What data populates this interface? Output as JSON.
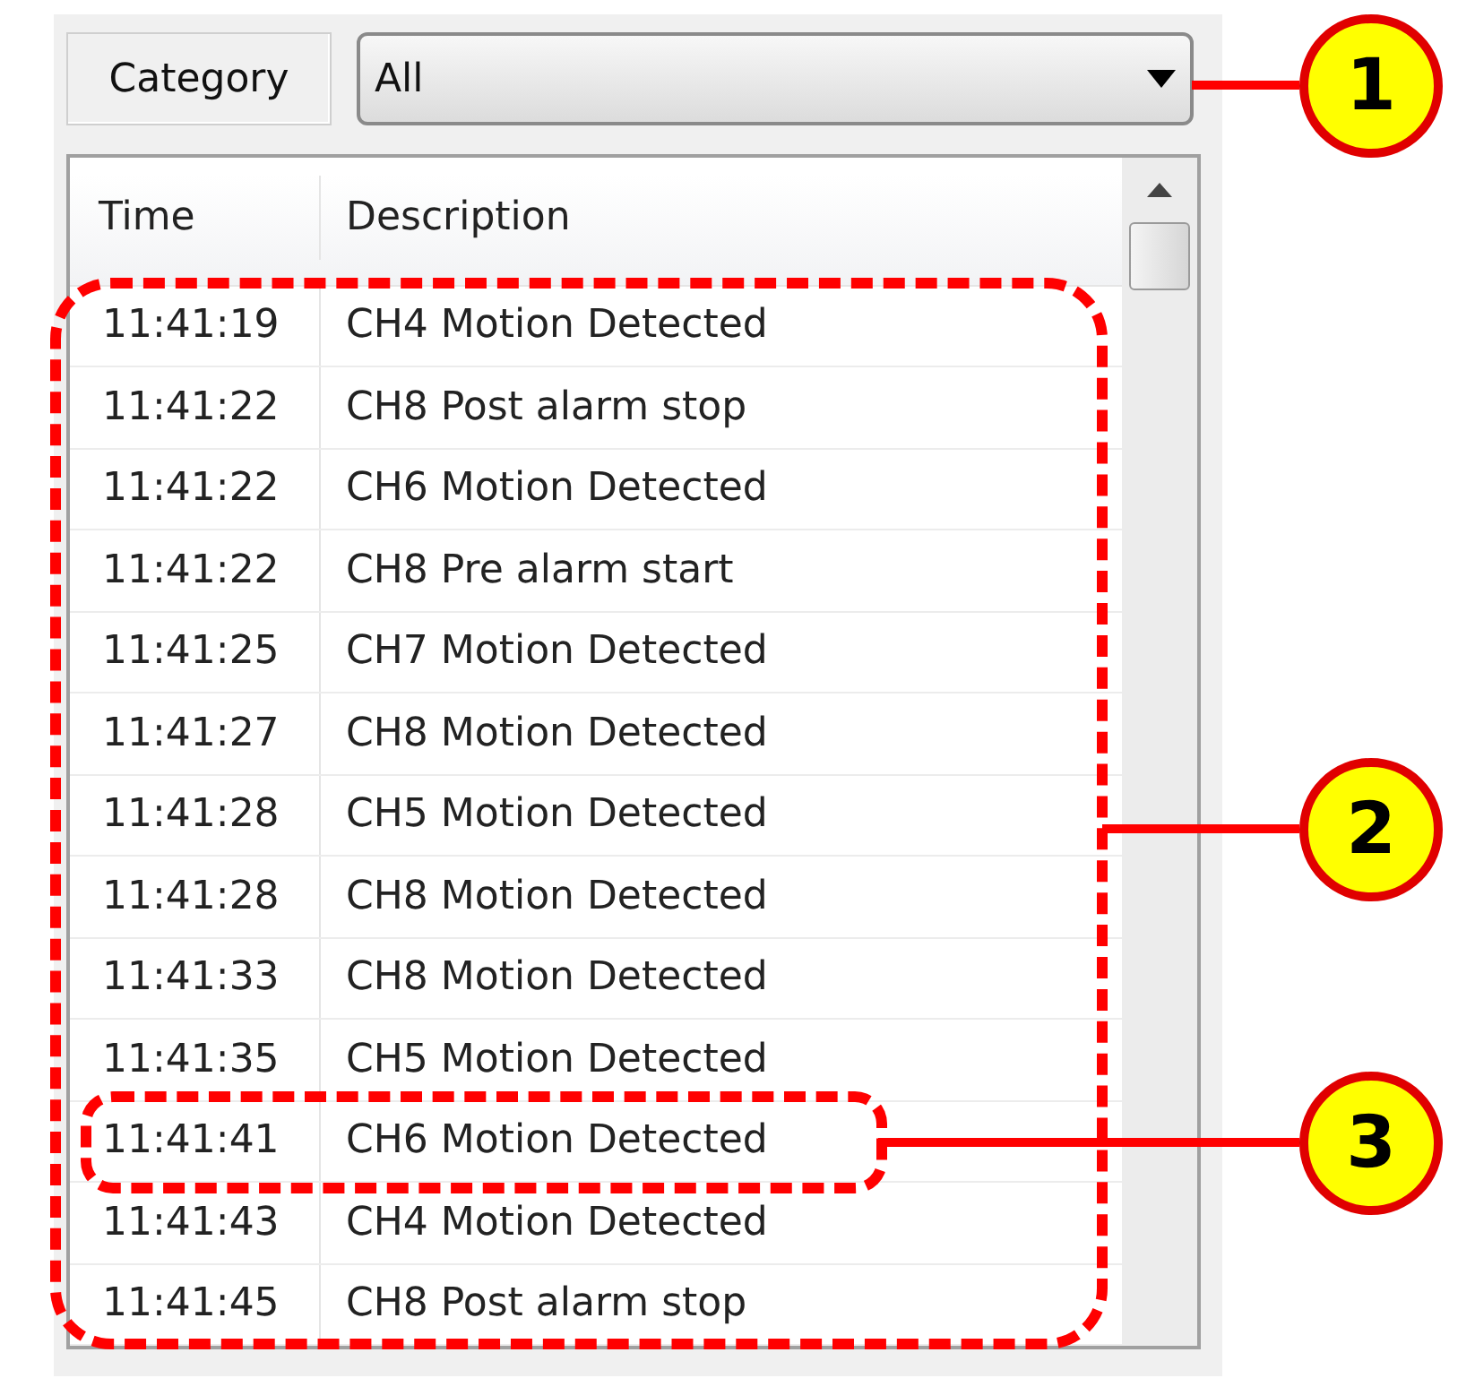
{
  "filter": {
    "label": "Category",
    "value": "All"
  },
  "table": {
    "columns": [
      "Time",
      "Description"
    ],
    "rows": [
      {
        "time": "11:41:19",
        "description": "CH4 Motion Detected"
      },
      {
        "time": "11:41:22",
        "description": "CH8 Post alarm stop"
      },
      {
        "time": "11:41:22",
        "description": "CH6 Motion Detected"
      },
      {
        "time": "11:41:22",
        "description": "CH8 Pre alarm start"
      },
      {
        "time": "11:41:25",
        "description": "CH7 Motion Detected"
      },
      {
        "time": "11:41:27",
        "description": "CH8 Motion Detected"
      },
      {
        "time": "11:41:28",
        "description": "CH5 Motion Detected"
      },
      {
        "time": "11:41:28",
        "description": "CH8 Motion Detected"
      },
      {
        "time": "11:41:33",
        "description": "CH8 Motion Detected"
      },
      {
        "time": "11:41:35",
        "description": "CH5 Motion Detected"
      },
      {
        "time": "11:41:41",
        "description": "CH6 Motion Detected"
      },
      {
        "time": "11:41:43",
        "description": "CH4 Motion Detected"
      },
      {
        "time": "11:41:45",
        "description": "CH8 Post alarm stop"
      }
    ]
  },
  "callouts": [
    {
      "number": "1"
    },
    {
      "number": "2"
    },
    {
      "number": "3"
    }
  ]
}
